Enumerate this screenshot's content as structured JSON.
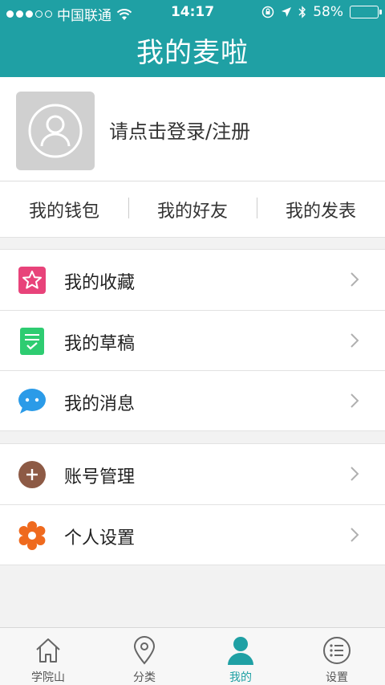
{
  "status_bar": {
    "carrier": "中国联通",
    "time": "14:17",
    "battery": "58%",
    "battery_level": 0.58,
    "signal_icon": "signal-dots-icon",
    "wifi_icon": "wifi-icon",
    "lock_icon": "rotation-lock-icon",
    "location_icon": "location-arrow-icon",
    "bluetooth_icon": "bluetooth-icon"
  },
  "header": {
    "title": "我的麦啦",
    "background": "#1fa0a4"
  },
  "profile": {
    "login_text": "请点击登录/注册",
    "avatar_icon": "user-avatar-icon"
  },
  "quick_links": [
    {
      "label": "我的钱包"
    },
    {
      "label": "我的好友"
    },
    {
      "label": "我的发表"
    }
  ],
  "menu_group_1": [
    {
      "label": "我的收藏",
      "icon": "star-icon",
      "color": "#e8437a"
    },
    {
      "label": "我的草稿",
      "icon": "draft-icon",
      "color": "#2ecc71"
    },
    {
      "label": "我的消息",
      "icon": "chat-bubble-icon",
      "color": "#2b9be8"
    }
  ],
  "menu_group_2": [
    {
      "label": "账号管理",
      "icon": "plus-circle-icon",
      "color": "#8d5a45"
    },
    {
      "label": "个人设置",
      "icon": "gear-icon",
      "color": "#ef6a1e"
    }
  ],
  "tabbar": {
    "accent": "#1fa0a4",
    "tabs": [
      {
        "label": "学院山",
        "icon": "home-icon"
      },
      {
        "label": "分类",
        "icon": "map-pin-icon"
      },
      {
        "label": "我的",
        "icon": "person-icon",
        "active": true
      },
      {
        "label": "设置",
        "icon": "list-icon"
      }
    ]
  }
}
